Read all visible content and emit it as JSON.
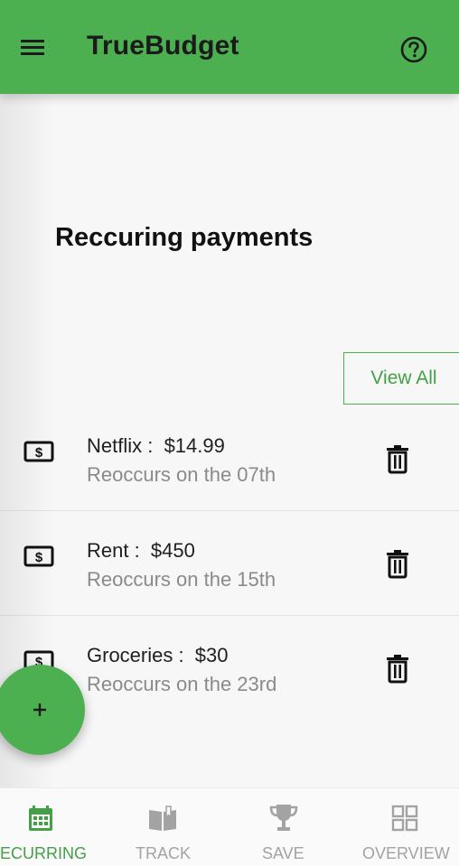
{
  "app": {
    "title": "TrueBudget",
    "menu_icon": "hamburger-menu-icon",
    "help_icon": "help-circle-icon",
    "accent_color": "#4caf50"
  },
  "page": {
    "title": "Reccuring payments",
    "view_all_label": "View All"
  },
  "payments": [
    {
      "name_amount": "Netflix :  $14.99",
      "recurrence": "Reoccurs on the 07th",
      "icon": "money-bill-icon",
      "action_icon": "trash-icon"
    },
    {
      "name_amount": "Rent :  $450",
      "recurrence": "Reoccurs on the 15th",
      "icon": "money-bill-icon",
      "action_icon": "trash-icon"
    },
    {
      "name_amount": "Groceries :  $30",
      "recurrence": "Reoccurs on the 23rd",
      "icon": "money-bill-icon",
      "action_icon": "trash-icon"
    }
  ],
  "fab": {
    "label": "+",
    "icon": "plus-icon"
  },
  "bottom_nav": [
    {
      "label": "ECURRING",
      "icon": "calendar-icon",
      "active": true
    },
    {
      "label": "TRACK",
      "icon": "book-icon",
      "active": false
    },
    {
      "label": "SAVE",
      "icon": "trophy-icon",
      "active": false
    },
    {
      "label": "OVERVIEW",
      "icon": "grid-icon",
      "active": false
    }
  ]
}
